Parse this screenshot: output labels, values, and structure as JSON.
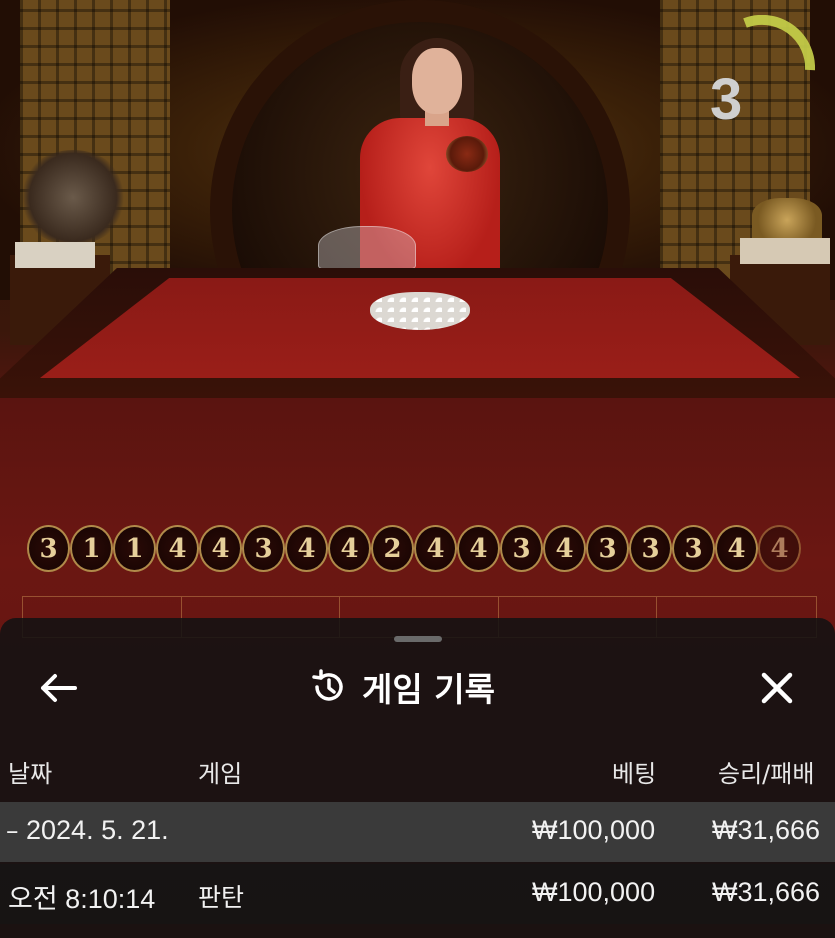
{
  "timer": {
    "value": "3",
    "progress": 0.25
  },
  "history": [
    "3",
    "1",
    "1",
    "4",
    "4",
    "3",
    "4",
    "4",
    "2",
    "4",
    "4",
    "3",
    "4",
    "3",
    "3",
    "3",
    "4",
    "4"
  ],
  "sheet": {
    "title": "게임 기록",
    "columns": {
      "date": "날짜",
      "game": "게임",
      "bet": "베팅",
      "result": "승리/패배"
    },
    "date_group": {
      "date": "2024. 5. 21.",
      "bet": "₩100,000",
      "result": "₩31,666"
    },
    "rows": [
      {
        "time": "오전 8:10:14",
        "game": "판탄",
        "bet": "₩100,000",
        "result": "₩31,666"
      }
    ]
  },
  "colors": {
    "accent_gold": "#b08a4a",
    "sheet_bg": "#121212",
    "timer_ring": "#c8d24a"
  }
}
